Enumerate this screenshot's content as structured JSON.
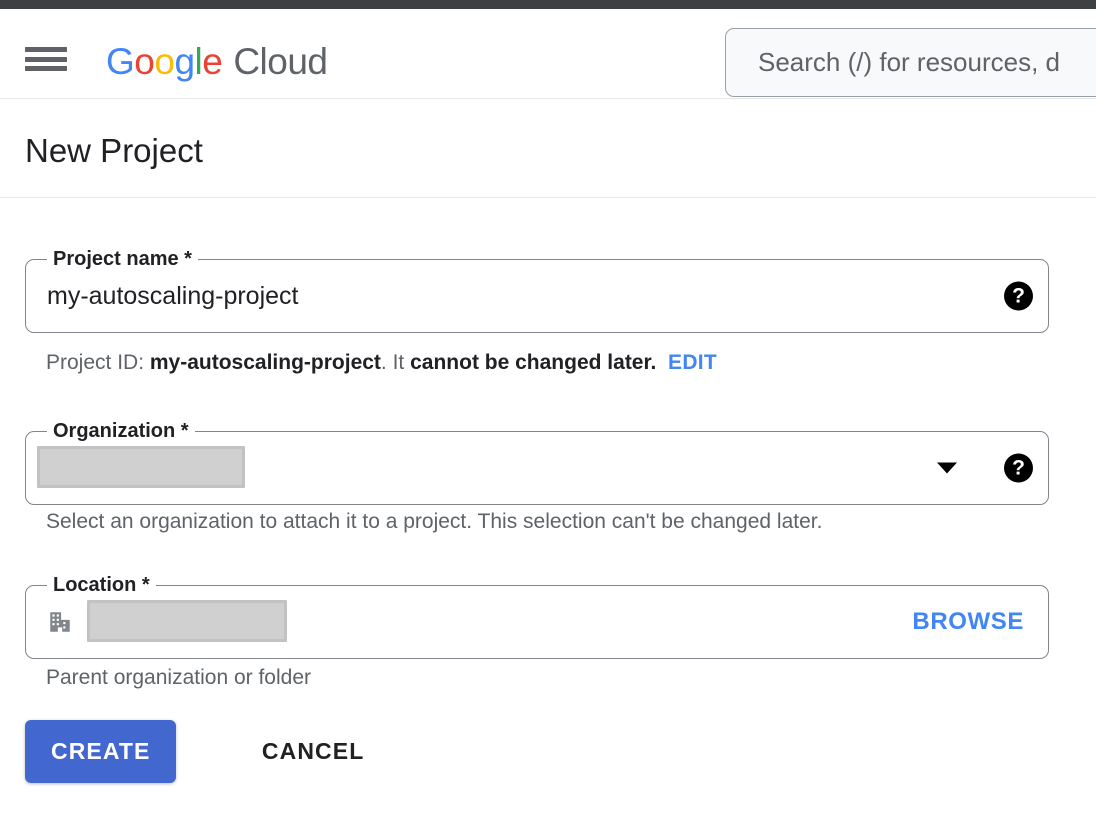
{
  "topbar": {
    "color": "#3f4042"
  },
  "header": {
    "menu_icon": "hamburger-menu-icon",
    "brand": {
      "google": "Google",
      "letters": [
        "G",
        "o",
        "o",
        "g",
        "l",
        "e"
      ],
      "cloud": "Cloud"
    },
    "search": {
      "icon": "search-icon",
      "placeholder": "Search (/) for resources, d",
      "value": ""
    }
  },
  "page": {
    "title": "New Project"
  },
  "form": {
    "project_name": {
      "label": "Project name *",
      "value": "my-autoscaling-project",
      "help_icon": "help-circle-icon",
      "help_glyph": "?"
    },
    "project_id_helper": {
      "prefix": "Project ID: ",
      "id": "my-autoscaling-project",
      "middle": ". It ",
      "emphasis": "cannot be changed later.",
      "edit_label": "EDIT"
    },
    "organization": {
      "label": "Organization *",
      "value": "",
      "redacted": true,
      "dropdown_icon": "chevron-down-icon",
      "help_icon": "help-circle-icon",
      "help_glyph": "?",
      "helper": "Select an organization to attach it to a project. This selection can't be changed later."
    },
    "location": {
      "label": "Location *",
      "value": "",
      "redacted": true,
      "icon": "building-icon",
      "browse_label": "BROWSE",
      "helper": "Parent organization or folder"
    }
  },
  "actions": {
    "create_label": "CREATE",
    "cancel_label": "CANCEL"
  },
  "colors": {
    "accent_blue": "#4285f4",
    "button_blue": "#4267ce",
    "text_primary": "#202124",
    "text_secondary": "#5f6368",
    "border": "#80868b",
    "redaction": "#d0d0d0"
  }
}
